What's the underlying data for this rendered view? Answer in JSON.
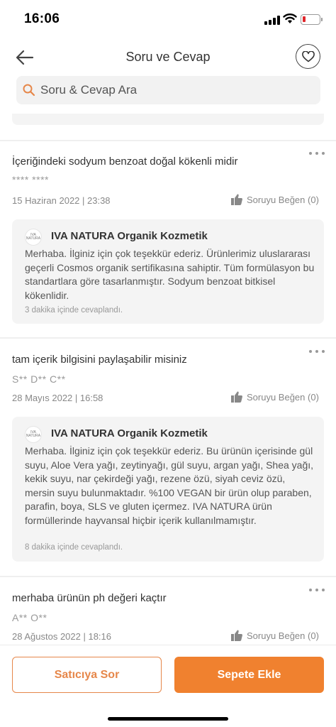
{
  "status_bar": {
    "time": "16:06"
  },
  "header": {
    "title": "Soru ve Cevap"
  },
  "search": {
    "placeholder": "Soru & Cevap Ara"
  },
  "questions": [
    {
      "question": "İçeriğindeki sodyum benzoat doğal kökenli midir",
      "author": "**** ****",
      "date": "15 Haziran 2022 | 23:38",
      "like_label": "Soruyu Beğen (0)",
      "answer": {
        "seller": "IVA NATURA Organik Kozmetik",
        "logo_text": "IVA NATURA",
        "text": "Merhaba. İlginiz için çok teşekkür ederiz. Ürünlerimiz uluslararası geçerli Cosmos organik sertifikasına sahiptir. Tüm formülasyon bu standartlara göre tasarlanmıştır. Sodyum benzoat bitkisel kökenlidir.",
        "time": "3 dakika içinde cevaplandı."
      }
    },
    {
      "question": "tam içerik bilgisini paylaşabilir misiniz",
      "author": "S** D** C**",
      "date": "28 Mayıs 2022 | 16:58",
      "like_label": "Soruyu Beğen (0)",
      "answer": {
        "seller": "IVA NATURA Organik Kozmetik",
        "logo_text": "IVA NATURA",
        "text": "Merhaba. İlginiz için çok teşekkür ederiz. Bu ürünün içerisinde gül suyu, Aloe Vera yağı, zeytinyağı, gül suyu, argan yağı, Shea yağı, kekik suyu, nar çekirdeği yağı, rezene özü, siyah ceviz özü, mersin suyu bulunmaktadır. %100 VEGAN bir ürün olup paraben, parafin, boya, SLS ve gluten içermez. IVA NATURA ürün formüllerinde hayvansal hiçbir içerik kullanılmamıştır.",
        "time": "8 dakika içinde cevaplandı."
      }
    },
    {
      "question": "merhaba ürünün ph değeri kaçtır",
      "author": "A** O**",
      "date": "28 Ağustos 2022 | 18:16",
      "like_label": "Soruyu Beğen (0)"
    }
  ],
  "actions": {
    "ask_seller": "Satıcıya Sor",
    "add_to_cart": "Sepete Ekle"
  },
  "colors": {
    "accent": "#f0812f",
    "accent_outline": "#e6874a",
    "battery_low": "#e0262b"
  }
}
